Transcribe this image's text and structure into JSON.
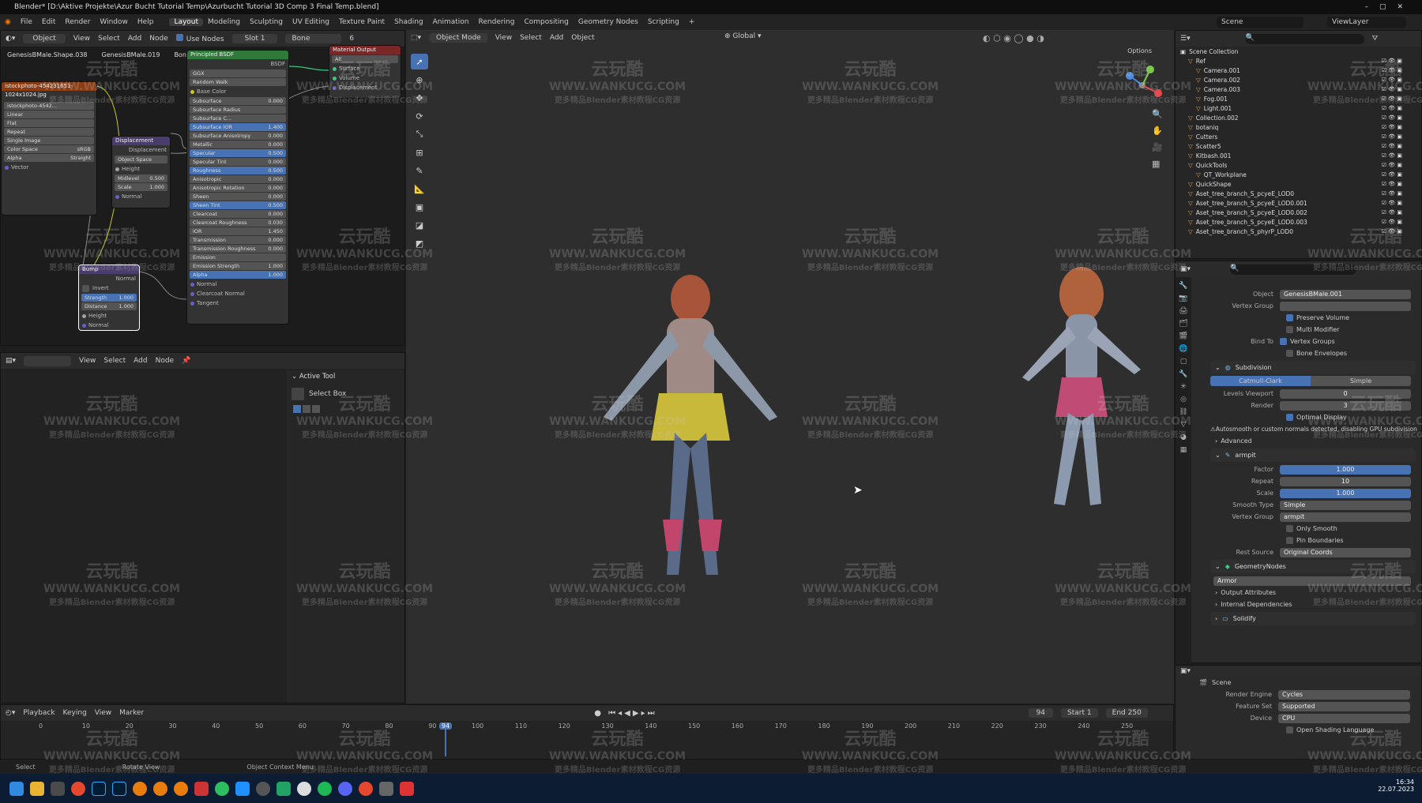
{
  "title_bar": {
    "text": "Blender* [D:\\Aktive Projekte\\Azur Bucht Tutorial Temp\\Azurbucht Tutorial 3D Comp 3 Final Temp.blend]"
  },
  "menu": {
    "items": [
      "File",
      "Edit",
      "Render",
      "Window",
      "Help"
    ],
    "workspaces": [
      "Layout",
      "Modeling",
      "Sculpting",
      "UV Editing",
      "Texture Paint",
      "Shading",
      "Animation",
      "Rendering",
      "Compositing",
      "Geometry Nodes",
      "Scripting"
    ],
    "active_workspace": "Layout",
    "add_tab": "+",
    "scene": "Scene",
    "view_layer": "ViewLayer"
  },
  "node_editor": {
    "header": {
      "object": "Object",
      "view": "View",
      "select": "Select",
      "add": "Add",
      "node": "Node",
      "use_nodes": "Use Nodes",
      "slot": "Slot 1",
      "material": "Bone",
      "users": "6"
    },
    "breadcrumb": [
      "GenesisBMale.Shape.038",
      "GenesisBMale.019",
      "Bone"
    ],
    "image_node": {
      "title": "istockphoto-454231651-1024x1024.jpg",
      "image": "istockphoto-4542...",
      "rows": [
        "Linear",
        "Flat",
        "Repeat",
        "Single Image",
        "Color Space",
        "sRGB",
        "Alpha",
        "Straight",
        "Vector"
      ]
    },
    "displacement": {
      "title": "Displacement",
      "out": "Displacement",
      "space": "Object Space",
      "rows": [
        "Height",
        "Midlevel",
        "Scale",
        "Normal"
      ],
      "midlevel": "0.500",
      "scale": "1.000"
    },
    "bump": {
      "title": "Bump",
      "out": "Normal",
      "invert": "Invert",
      "strength": "Strength",
      "strength_val": "1.000",
      "distance": "Distance",
      "distance_val": "1.000",
      "rows": [
        "Height",
        "Normal"
      ]
    },
    "bsdf": {
      "title": "Principled BSDF",
      "out": "BSDF",
      "ggx": "GGX",
      "walk": "Random Walk",
      "base_color": "Base Color",
      "fields": [
        [
          "Subsurface",
          "0.000"
        ],
        [
          "Subsurface Radius",
          ""
        ],
        [
          "Subsurface C...",
          ""
        ],
        [
          "Subsurface IOR",
          "1.400"
        ],
        [
          "Subsurface Anisotropy",
          "0.000"
        ],
        [
          "Metallic",
          "0.000"
        ],
        [
          "Specular",
          "0.500"
        ],
        [
          "Specular Tint",
          "0.000"
        ],
        [
          "Roughness",
          "0.500"
        ],
        [
          "Anisotropic",
          "0.000"
        ],
        [
          "Anisotropic Rotation",
          "0.000"
        ],
        [
          "Sheen",
          "0.000"
        ],
        [
          "Sheen Tint",
          "0.500"
        ],
        [
          "Clearcoat",
          "0.000"
        ],
        [
          "Clearcoat Roughness",
          "0.030"
        ],
        [
          "IOR",
          "1.450"
        ],
        [
          "Transmission",
          "0.000"
        ],
        [
          "Transmission Roughness",
          "0.000"
        ],
        [
          "Emission",
          ""
        ],
        [
          "Emission Strength",
          "1.000"
        ],
        [
          "Alpha",
          "1.000"
        ]
      ],
      "tail": [
        "Normal",
        "Clearcoat Normal",
        "Tangent"
      ]
    },
    "output": {
      "title": "Material Output",
      "target": "All",
      "rows": [
        "Surface",
        "Volume",
        "Displacement"
      ]
    }
  },
  "lower_editor": {
    "header": {
      "view": "View",
      "select": "Select",
      "add": "Add",
      "node": "Node"
    },
    "active_tool": "Active Tool",
    "select_box": "Select Box"
  },
  "viewport": {
    "mode": "Object Mode",
    "view": "View",
    "select": "Select",
    "add": "Add",
    "object": "Object",
    "orientation": "Global",
    "options": "Options"
  },
  "outliner": {
    "title": "Scene Collection",
    "rows": [
      {
        "name": "Ref",
        "indent": 1
      },
      {
        "name": "Camera.001",
        "indent": 2
      },
      {
        "name": "Camera.002",
        "indent": 2
      },
      {
        "name": "Camera.003",
        "indent": 2
      },
      {
        "name": "Fog.001",
        "indent": 2
      },
      {
        "name": "Light.001",
        "indent": 2
      },
      {
        "name": "Collection.002",
        "indent": 1
      },
      {
        "name": "botaniq",
        "indent": 1
      },
      {
        "name": "Cutters",
        "indent": 1
      },
      {
        "name": "Scatter5",
        "indent": 1
      },
      {
        "name": "Kitbash.001",
        "indent": 1
      },
      {
        "name": "QuickTools",
        "indent": 1
      },
      {
        "name": "QT_Workplane",
        "indent": 2
      },
      {
        "name": "QuickShape",
        "indent": 1
      },
      {
        "name": "Aset_tree_branch_S_pcyeE_LOD0",
        "indent": 1
      },
      {
        "name": "Aset_tree_branch_S_pcyeE_LOD0.001",
        "indent": 1
      },
      {
        "name": "Aset_tree_branch_S_pcyeE_LOD0.002",
        "indent": 1
      },
      {
        "name": "Aset_tree_branch_S_pcyeE_LOD0.003",
        "indent": 1
      },
      {
        "name": "Aset_tree_branch_S_phyrP_LOD0",
        "indent": 1
      }
    ]
  },
  "properties": {
    "armature": {
      "object_label": "Object",
      "object": "GenesisBMale.001",
      "vgroup_label": "Vertex Group",
      "preserve_volume": "Preserve Volume",
      "multi_modifier": "Multi Modifier",
      "bind_to": "Bind To",
      "vertex_groups": "Vertex Groups",
      "bone_envelopes": "Bone Envelopes"
    },
    "subdivision": {
      "name": "Subdivision",
      "catmull": "Catmull-Clark",
      "simple": "Simple",
      "levels_label": "Levels Viewport",
      "levels": "0",
      "render_label": "Render",
      "render": "3",
      "optimal": "Optimal Display",
      "warning": "Autosmooth or custom normals detected, disabling GPU subdivision",
      "advanced": "Advanced"
    },
    "smooth": {
      "name": "armpit",
      "factor_label": "Factor",
      "factor": "1.000",
      "repeat_label": "Repeat",
      "repeat": "10",
      "scale_label": "Scale",
      "scale": "1.000",
      "type_label": "Smooth Type",
      "type": "Simple",
      "vgroup_label": "Vertex Group",
      "vgroup": "armpit",
      "only_smooth": "Only Smooth",
      "pin": "Pin Boundaries",
      "rest_label": "Rest Source",
      "rest": "Original Coords"
    },
    "geonodes": {
      "name": "GeometryNodes",
      "tree": "Armor",
      "output_attrs": "Output Attributes",
      "internal_deps": "Internal Dependencies"
    },
    "solidify": {
      "name": "Solidify"
    }
  },
  "render_props": {
    "scene": "Scene",
    "engine_label": "Render Engine",
    "engine": "Cycles",
    "feature_label": "Feature Set",
    "feature": "Supported",
    "device_label": "Device",
    "device": "CPU",
    "osl": "Open Shading Language"
  },
  "timeline": {
    "playback": "Playback",
    "keying": "Keying",
    "view": "View",
    "marker": "Marker",
    "current": "94",
    "start_label": "Start",
    "start": "1",
    "end_label": "End",
    "end": "250",
    "ticks": [
      "0",
      "10",
      "20",
      "30",
      "40",
      "50",
      "60",
      "70",
      "80",
      "90",
      "100",
      "110",
      "120",
      "130",
      "140",
      "150",
      "160",
      "170",
      "180",
      "190",
      "200",
      "210",
      "220",
      "230",
      "240",
      "250"
    ]
  },
  "status": {
    "select": "Select",
    "rotate": "Rotate View",
    "context": "Object Context Menu",
    "time": "16:34",
    "date": "22.07.2023"
  },
  "watermark": {
    "logo": "云玩酷",
    "url": "WWW.WANKUCG.COM",
    "sub": "更多精品Blender素材教程CG资源"
  }
}
